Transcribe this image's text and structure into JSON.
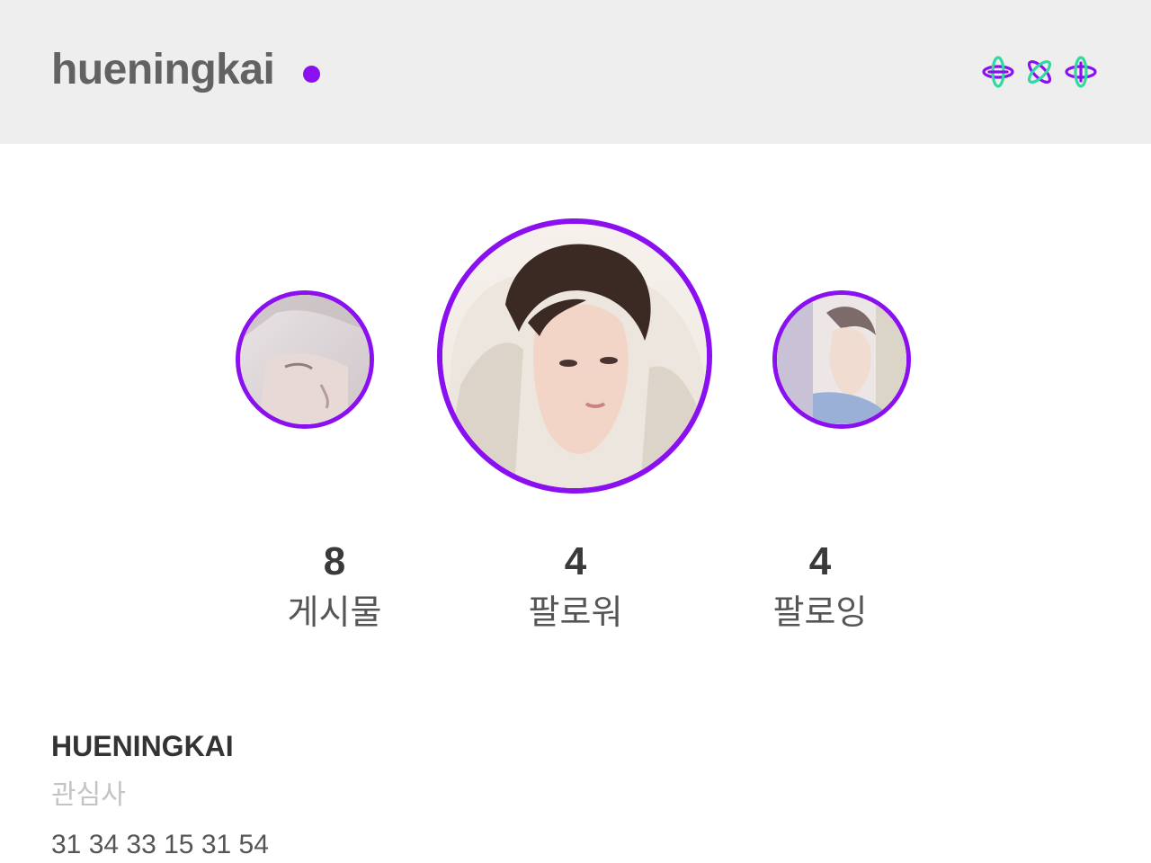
{
  "header": {
    "username": "hueningkai",
    "status_color": "#8b10f0",
    "logo_icon": "txt-logo-icon"
  },
  "avatars": {
    "left": "story-highlight-avatar",
    "center": "profile-avatar",
    "right": "story-highlight-avatar"
  },
  "stats": {
    "posts": {
      "value": "8",
      "label": "게시물"
    },
    "followers": {
      "value": "4",
      "label": "팔로워"
    },
    "following": {
      "value": "4",
      "label": "팔로잉"
    }
  },
  "profile": {
    "display_name": "HUENINGKAI",
    "category": "관심사",
    "bio": "31 34 33 15 31 54"
  },
  "colors": {
    "accent": "#8b10f0",
    "header_bg": "#efeeef",
    "logo_green": "#2fd9a0"
  }
}
